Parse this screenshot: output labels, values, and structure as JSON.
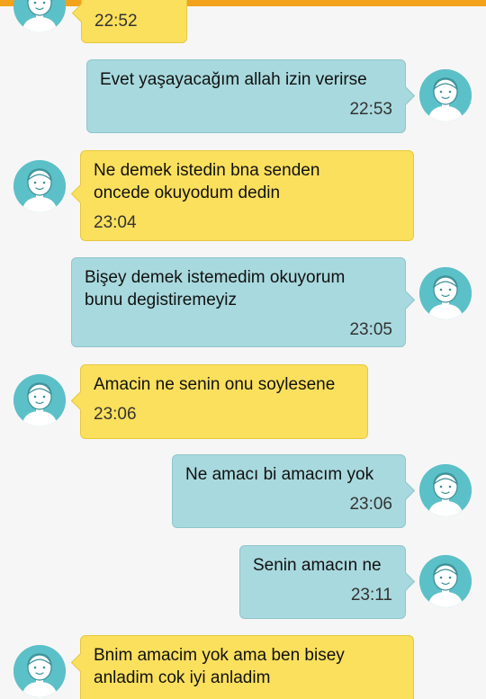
{
  "colors": {
    "accent": "#f3a21b",
    "incoming_bubble": "#fbe05d",
    "outgoing_bubble": "#a8d9de",
    "avatar": "#5cc0c8"
  },
  "avatar_icon": "person-avatar-icon",
  "messages": [
    {
      "direction": "in",
      "text": "",
      "time": "22:52"
    },
    {
      "direction": "out",
      "text": "Evet yaşayacağım allah izin verirse",
      "time": "22:53"
    },
    {
      "direction": "in",
      "text": "Ne demek istedin bna senden\noncede okuyodum dedin",
      "time": "23:04"
    },
    {
      "direction": "out",
      "text": "Bişey demek istemedim okuyorum\nbunu degistiremeyiz",
      "time": "23:05"
    },
    {
      "direction": "in",
      "text": "Amacin ne senin onu soylesene",
      "time": "23:06"
    },
    {
      "direction": "out",
      "text": "Ne amacı bi amacım yok",
      "time": "23:06"
    },
    {
      "direction": "out",
      "text": "Senin amacın ne",
      "time": "23:11"
    },
    {
      "direction": "in",
      "text": "Bnim amacim yok ama ben bisey\nanladim cok iyi anladim",
      "time": ""
    }
  ]
}
